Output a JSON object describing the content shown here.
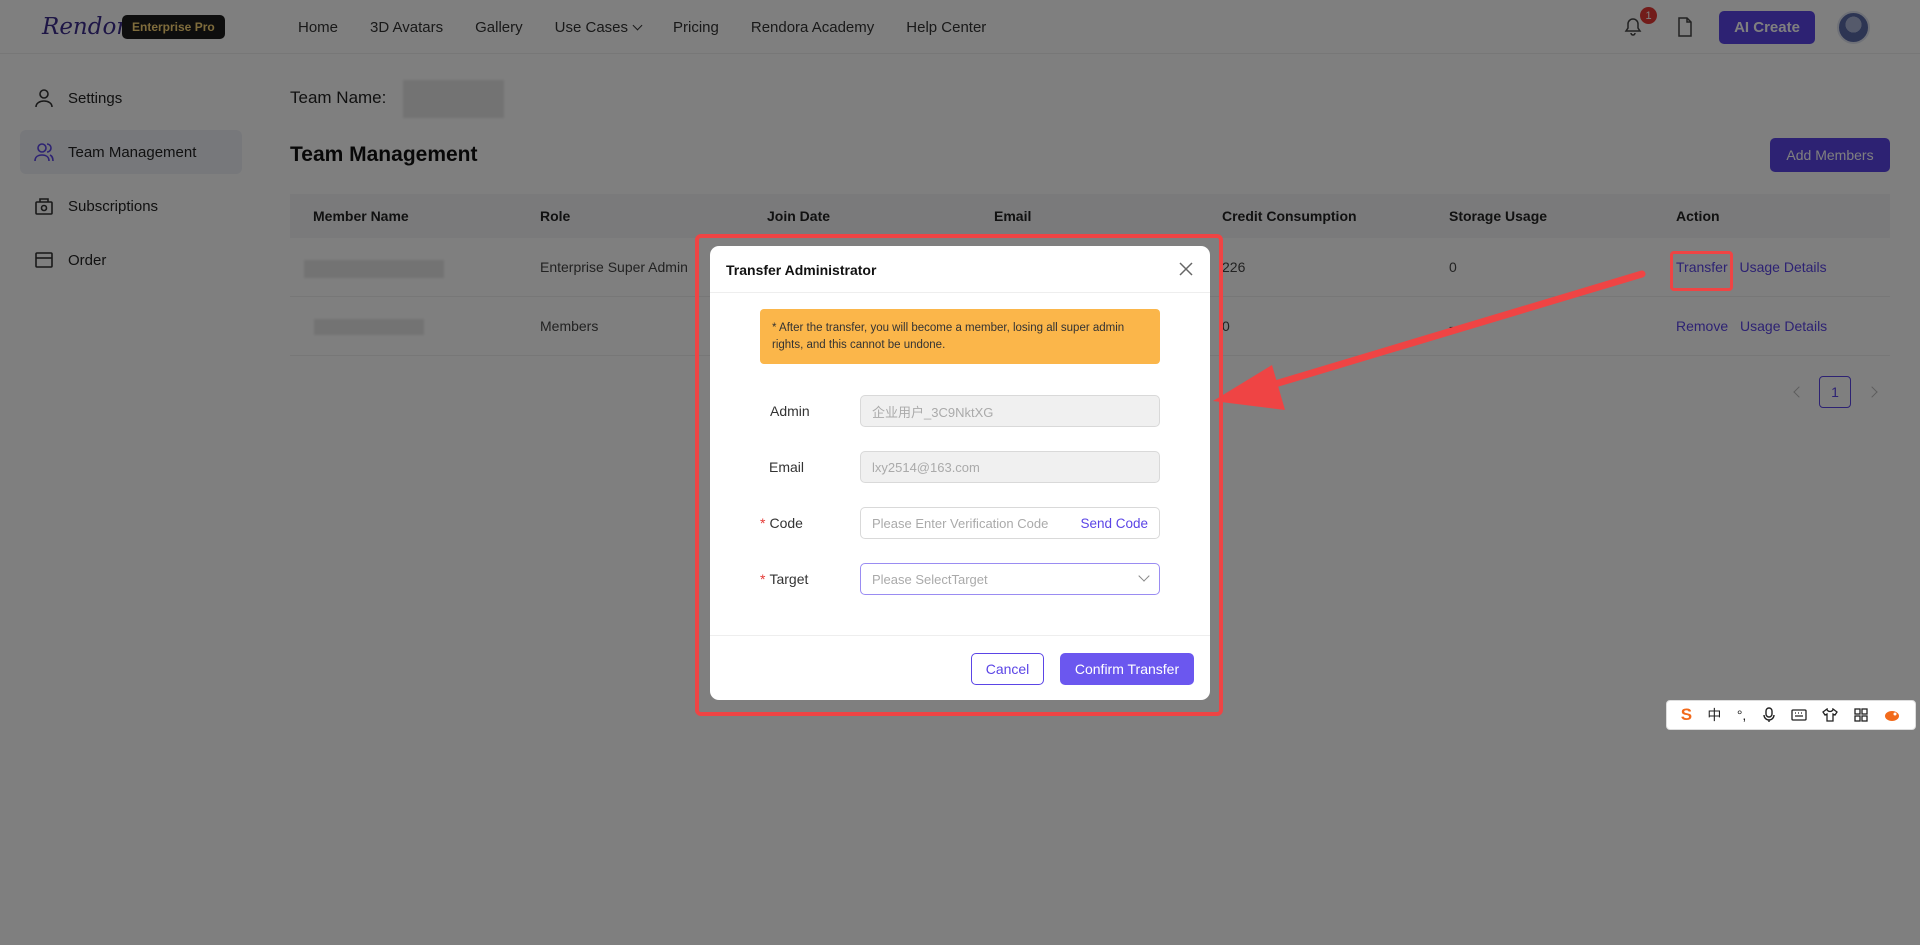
{
  "header": {
    "logo": "Rendora",
    "plan_badge": "Enterprise Pro",
    "nav": [
      "Home",
      "3D Avatars",
      "Gallery",
      "Use Cases",
      "Pricing",
      "Rendora Academy",
      "Help Center"
    ],
    "notification_count": "1",
    "ai_create_label": "AI Create"
  },
  "sidebar": {
    "items": [
      {
        "label": "Settings",
        "icon": "user-icon"
      },
      {
        "label": "Team Management",
        "icon": "team-icon"
      },
      {
        "label": "Subscriptions",
        "icon": "subscriptions-icon"
      },
      {
        "label": "Order",
        "icon": "order-icon"
      }
    ]
  },
  "main": {
    "team_name_label": "Team Name:",
    "title": "Team Management",
    "add_members_label": "Add Members",
    "table": {
      "headers": [
        "Member Name",
        "Role",
        "Join Date",
        "Email",
        "Credit Consumption",
        "Storage Usage",
        "Action"
      ],
      "rows": [
        {
          "role": "Enterprise Super Admin",
          "credit": "226",
          "storage": "0",
          "actions": [
            "Transfer",
            "Usage Details"
          ]
        },
        {
          "role": "Members",
          "credit": "0",
          "storage": "-",
          "actions": [
            "Remove",
            "Usage Details"
          ]
        }
      ]
    },
    "pagination": {
      "current_page": "1"
    }
  },
  "modal": {
    "title": "Transfer Administrator",
    "warning": "* After the transfer, you will become a member, losing all super admin rights, and this cannot be undone.",
    "admin_label": "Admin",
    "admin_value": "企业用户_3C9NktXG",
    "email_label": "Email",
    "email_value": "lxy2514@163.com",
    "code_label": "Code",
    "code_placeholder": "Please Enter Verification Code",
    "send_code_label": "Send Code",
    "target_label": "Target",
    "target_placeholder": "Please SelectTarget",
    "cancel_label": "Cancel",
    "confirm_label": "Confirm Transfer"
  },
  "ime_toolbar": {
    "logo": "S",
    "items": [
      "中",
      "°,"
    ]
  },
  "colors": {
    "accent": "#5b45e6",
    "warning": "#fbb64a",
    "annotation": "#ef4444"
  }
}
